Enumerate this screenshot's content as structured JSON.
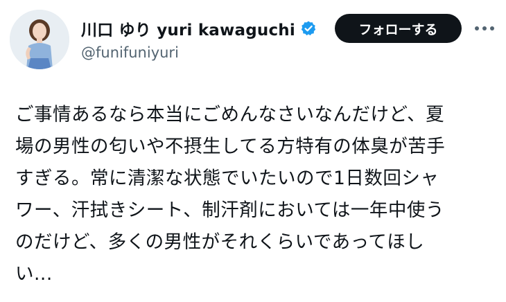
{
  "author": {
    "display_name": "川口 ゆり yuri kawaguchi",
    "handle": "@funifuniyuri",
    "verified": true,
    "verified_icon": "verified-badge-icon",
    "verified_color": "#1d9bf0"
  },
  "actions": {
    "follow_label": "フォローする",
    "more_icon": "more-horizontal-icon"
  },
  "tweet": {
    "lines": [
      "ご事情あるなら本当にごめんなさいなんだけど、夏",
      "場の男性の匂いや不摂生してる方特有の体臭が苦手",
      "すぎる。常に清潔な状態でいたいので1日数回シャ",
      "ワー、汗拭きシート、制汗剤においては一年中使う",
      "のだけど、多くの男性がそれくらいであってほし",
      "い..."
    ]
  },
  "colors": {
    "text": "#0f1419",
    "secondary_text": "#536471",
    "button_bg": "#0f1419",
    "button_text": "#ffffff"
  }
}
